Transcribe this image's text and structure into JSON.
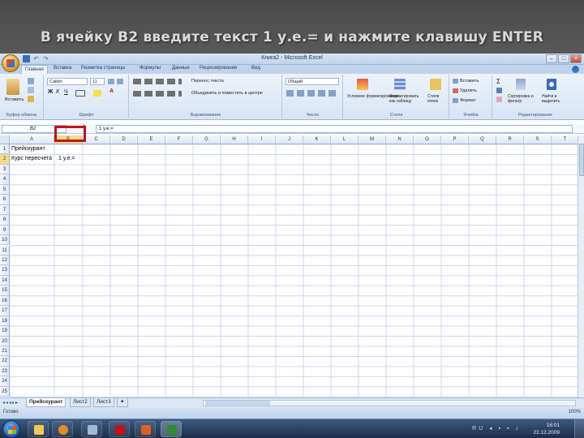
{
  "slide": {
    "title": "В ячейку В2 введите текст 1 у.е.= и нажмите клавишу ENTER"
  },
  "window": {
    "title": "Книга2 - Microsoft Excel"
  },
  "ribbon": {
    "tabs": [
      "Главная",
      "Вставка",
      "Разметка страницы",
      "Формулы",
      "Данные",
      "Рецензирование",
      "Вид"
    ],
    "font_name": "Calibri",
    "font_size": "11",
    "groups": {
      "clipboard": "Буфер обмена",
      "font": "Шрифт",
      "alignment": "Выравнивание",
      "number": "Число",
      "styles": "Стили",
      "cells": "Ячейки",
      "editing": "Редактирование"
    },
    "buttons": {
      "paste": "Вставить",
      "wrap_text": "Перенос текста",
      "merge_center": "Объединить и поместить в центре",
      "number_format": "Общий",
      "conditional_format": "Условное форматирование",
      "format_as_table": "Форматировать как таблицу",
      "cell_styles": "Стили ячеек",
      "insert": "Вставить",
      "delete": "Удалить",
      "format": "Формат",
      "sort_filter": "Сортировка и фильтр",
      "find_select": "Найти и выделить"
    }
  },
  "formula_bar": {
    "name_box": "B2",
    "fx": "fx",
    "content": "1 у.е.="
  },
  "grid": {
    "columns": [
      "A",
      "B",
      "C",
      "D",
      "E",
      "F",
      "G",
      "H",
      "I",
      "J",
      "K",
      "L",
      "M",
      "N",
      "O",
      "P",
      "Q",
      "R",
      "S",
      "T"
    ],
    "rows": [
      "1",
      "2",
      "3",
      "4",
      "5",
      "6",
      "7",
      "8",
      "9",
      "10",
      "11",
      "12",
      "13",
      "14",
      "15",
      "16",
      "17",
      "18",
      "19",
      "20",
      "21",
      "22",
      "23",
      "24",
      "25"
    ],
    "cells": {
      "A1": "Прейскурант",
      "A2": "Курс пересчета",
      "B2": "1 у.е.="
    }
  },
  "sheets": {
    "tabs": [
      "Прейскурант",
      "Лист2",
      "Лист3"
    ]
  },
  "status": {
    "ready": "Готово",
    "zoom": "100%"
  },
  "taskbar": {
    "lang": "RU",
    "time": "16:01",
    "date": "22.12.2009"
  }
}
